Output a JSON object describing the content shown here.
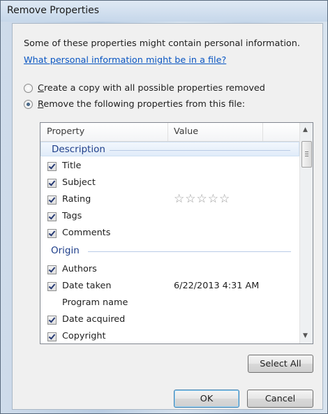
{
  "window": {
    "title": "Remove Properties"
  },
  "intro": {
    "text": "Some of these properties might contain personal information.",
    "link": "What personal information might be in a file?"
  },
  "options": {
    "copy": {
      "prefix": "",
      "mnemonic": "C",
      "rest": "reate a copy with all possible properties removed",
      "selected": false
    },
    "remove": {
      "prefix": "",
      "mnemonic": "R",
      "rest": "emove the following properties from this file:",
      "selected": true
    }
  },
  "list": {
    "columns": {
      "property": "Property",
      "value": "Value"
    },
    "groups": {
      "description": "Description",
      "origin": "Origin"
    },
    "description_items": [
      {
        "label": "Title",
        "checked": true,
        "value": ""
      },
      {
        "label": "Subject",
        "checked": true,
        "value": ""
      },
      {
        "label": "Rating",
        "checked": true,
        "value": "☆☆☆☆☆"
      },
      {
        "label": "Tags",
        "checked": true,
        "value": ""
      },
      {
        "label": "Comments",
        "checked": true,
        "value": ""
      }
    ],
    "origin_items": [
      {
        "label": "Authors",
        "checked": true,
        "value": ""
      },
      {
        "label": "Date taken",
        "checked": true,
        "value": "6/22/2013 4:31 AM"
      },
      {
        "label": "Program name",
        "checked": false,
        "value": ""
      },
      {
        "label": "Date acquired",
        "checked": true,
        "value": ""
      },
      {
        "label": "Copyright",
        "checked": true,
        "value": ""
      }
    ]
  },
  "buttons": {
    "select_all": "Select All",
    "ok": "OK",
    "cancel": "Cancel"
  }
}
